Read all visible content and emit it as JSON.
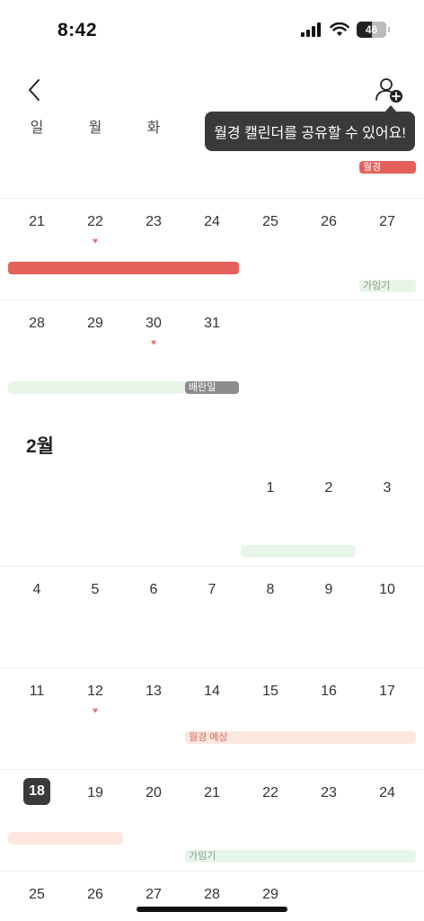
{
  "status_bar": {
    "time": "8:42",
    "battery": "46"
  },
  "header": {
    "back_icon": "chevron-left-icon",
    "share_icon": "person-add-icon"
  },
  "tooltip": {
    "text": "월경 캘린더를 공유할 수 있어요!"
  },
  "weekdays": [
    "일",
    "월",
    "화"
  ],
  "colors": {
    "period": "#e4605a",
    "fertile": "#e8f5e9",
    "ovulation": "#8c8c8c",
    "predicted": "#fde7df",
    "today": "#3a3a3a"
  },
  "january": {
    "week_a": {
      "period_label": "월경"
    },
    "week_b": {
      "days": [
        "21",
        "22",
        "23",
        "24",
        "25",
        "26",
        "27"
      ],
      "fertile_label": "가임기"
    },
    "week_c": {
      "days": [
        "28",
        "29",
        "30",
        "31"
      ],
      "ovulation_label": "배란일"
    }
  },
  "february": {
    "title": "2월",
    "week_1": {
      "days": [
        "1",
        "2",
        "3"
      ]
    },
    "week_2": {
      "days": [
        "4",
        "5",
        "6",
        "7",
        "8",
        "9",
        "10"
      ]
    },
    "week_3": {
      "days": [
        "11",
        "12",
        "13",
        "14",
        "15",
        "16",
        "17"
      ],
      "predicted_label": "월경 예상"
    },
    "week_4": {
      "days": [
        "18",
        "19",
        "20",
        "21",
        "22",
        "23",
        "24"
      ],
      "today": "18",
      "fertile_label": "가임기"
    },
    "week_5": {
      "days": [
        "25",
        "26",
        "27",
        "28",
        "29"
      ]
    }
  }
}
